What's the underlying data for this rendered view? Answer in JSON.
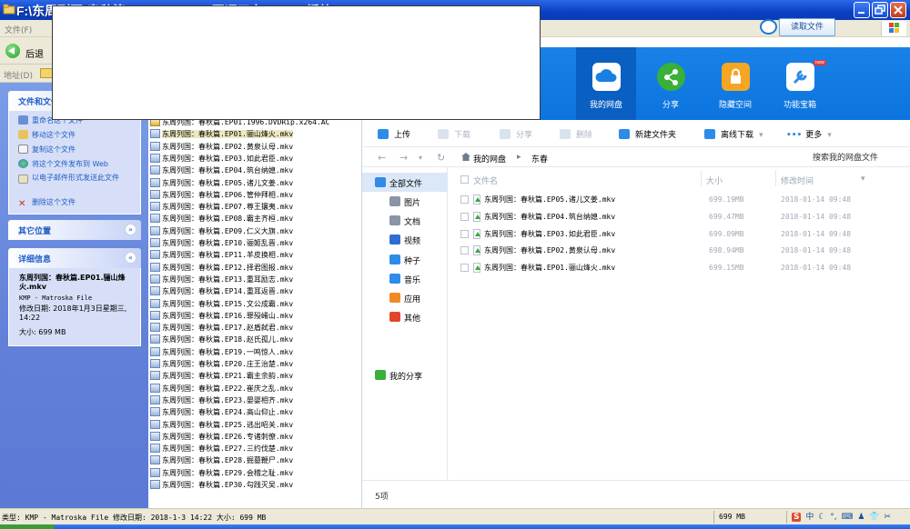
{
  "window": {
    "title": "F:\\东周列国·春秋篇 1996 DVDRip 国语无字 [KMP] 播放",
    "menu_file": "文件(F)"
  },
  "toolbar": {
    "back_label": "后退"
  },
  "address": {
    "label": "地址(D)"
  },
  "tasks": {
    "header": "文件和文件夹任务",
    "items": [
      "重命名这个文件",
      "移动这个文件",
      "复制这个文件",
      "将这个文件发布到 Web",
      "以电子邮件形式发送此文件",
      "删除这个文件"
    ]
  },
  "other_places": {
    "header": "其它位置"
  },
  "details": {
    "header": "详细信息",
    "file_title": "东周列国：春秋篇.EP01.骊山烽火.mkv",
    "file_type": "KMP - Matroska File",
    "modified": "修改日期: 2018年1月3日星期三, 14:22",
    "size": "大小: 699 MB"
  },
  "file_list": [
    "东周列国：春秋篇.EP01.1996.DVDRip.x264.AC",
    "东周列国：春秋篇.EP01.骊山烽火.mkv",
    "东周列国：春秋篇.EP02.黄泉认母.mkv",
    "东周列国：春秋篇.EP03.如此君臣.mkv",
    "东周列国：春秋篇.EP04.筑台纳媳.mkv",
    "东周列国：春秋篇.EP05.诸儿文姜.mkv",
    "东周列国：春秋篇.EP06.管仲拜相.mkv",
    "东周列国：春秋篇.EP07.尊王攘夷.mkv",
    "东周列国：春秋篇.EP08.霸主齐桓.mkv",
    "东周列国：春秋篇.EP09.仁义大旗.mkv",
    "东周列国：春秋篇.EP10.骊姬乱晋.mkv",
    "东周列国：春秋篇.EP11.羊皮换相.mkv",
    "东周列国：春秋篇.EP12.择君图报.mkv",
    "东周列国：春秋篇.EP13.重耳励志.mkv",
    "东周列国：春秋篇.EP14.重耳返晋.mkv",
    "东周列国：春秋篇.EP15.文公成霸.mkv",
    "东周列国：春秋篇.EP16.罪殁崤山.mkv",
    "东周列国：春秋篇.EP17.赵盾弑君.mkv",
    "东周列国：春秋篇.EP18.赵氏孤儿.mkv",
    "东周列国：春秋篇.EP19.一鸣惊人.mkv",
    "东周列国：春秋篇.EP20.庄王治楚.mkv",
    "东周列国：春秋篇.EP21.霸主余韵.mkv",
    "东周列国：春秋篇.EP22.崔庆之乱.mkv",
    "东周列国：春秋篇.EP23.晏婴相齐.mkv",
    "东周列国：春秋篇.EP24.高山仰止.mkv",
    "东周列国：春秋篇.EP25.逃出昭关.mkv",
    "东周列国：春秋篇.EP26.专诸刺僚.mkv",
    "东周列国：春秋篇.EP27.三约伐楚.mkv",
    "东周列国：春秋篇.EP28.掘墓鞭尸.mkv",
    "东周列国：春秋篇.EP29.会稽之耻.mkv",
    "东周列国：春秋篇.EP30.勾践灭吴.mkv"
  ],
  "pan": {
    "read_file_button": "读取文件",
    "nav": [
      {
        "label": "我的网盘",
        "icon": "cloud-icon",
        "color": "#ffffff"
      },
      {
        "label": "分享",
        "icon": "share-icon",
        "color": "#38b03a"
      },
      {
        "label": "隐藏空间",
        "icon": "lock-icon",
        "color": "#f5a623"
      },
      {
        "label": "功能宝箱",
        "icon": "toolbox-icon",
        "color": "#2e8be8"
      }
    ],
    "nav_badge": "new",
    "actions": {
      "upload": "上传",
      "download": "下载",
      "share": "分享",
      "delete": "删除",
      "new_folder": "新建文件夹",
      "offline_download": "离线下载",
      "more": "更多"
    },
    "path": {
      "root": "我的网盘",
      "current": "东春"
    },
    "search_placeholder": "搜索我的网盘文件",
    "sidebar": [
      "全部文件",
      "图片",
      "文档",
      "视频",
      "种子",
      "音乐",
      "应用",
      "其他",
      "我的分享"
    ],
    "table": {
      "col_name": "文件名",
      "col_size": "大小",
      "col_time": "修改时间",
      "rows": [
        {
          "name": "东周列国：春秋篇.EP05.诸儿文姜.mkv",
          "size": "699.19MB",
          "time": "2018-01-14 09:48"
        },
        {
          "name": "东周列国：春秋篇.EP04.筑台纳媳.mkv",
          "size": "699.47MB",
          "time": "2018-01-14 09:48"
        },
        {
          "name": "东周列国：春秋篇.EP03.如此君臣.mkv",
          "size": "699.09MB",
          "time": "2018-01-14 09:48"
        },
        {
          "name": "东周列国：春秋篇.EP02.黄泉认母.mkv",
          "size": "698.94MB",
          "time": "2018-01-14 09:48"
        },
        {
          "name": "东周列国：春秋篇.EP01.骊山烽火.mkv",
          "size": "699.15MB",
          "time": "2018-01-14 09:48"
        }
      ]
    },
    "footer_count": "5项"
  },
  "statusbar": {
    "text": "类型: KMP - Matroska File 修改日期: 2018-1-3 14:22 大小: 699 MB",
    "size": "699 MB"
  },
  "colors": {
    "xp_title": "#0a3fc4",
    "pan_header": "#1882e8",
    "task_pane": "#6280d8",
    "selection": "#ece9c2"
  }
}
